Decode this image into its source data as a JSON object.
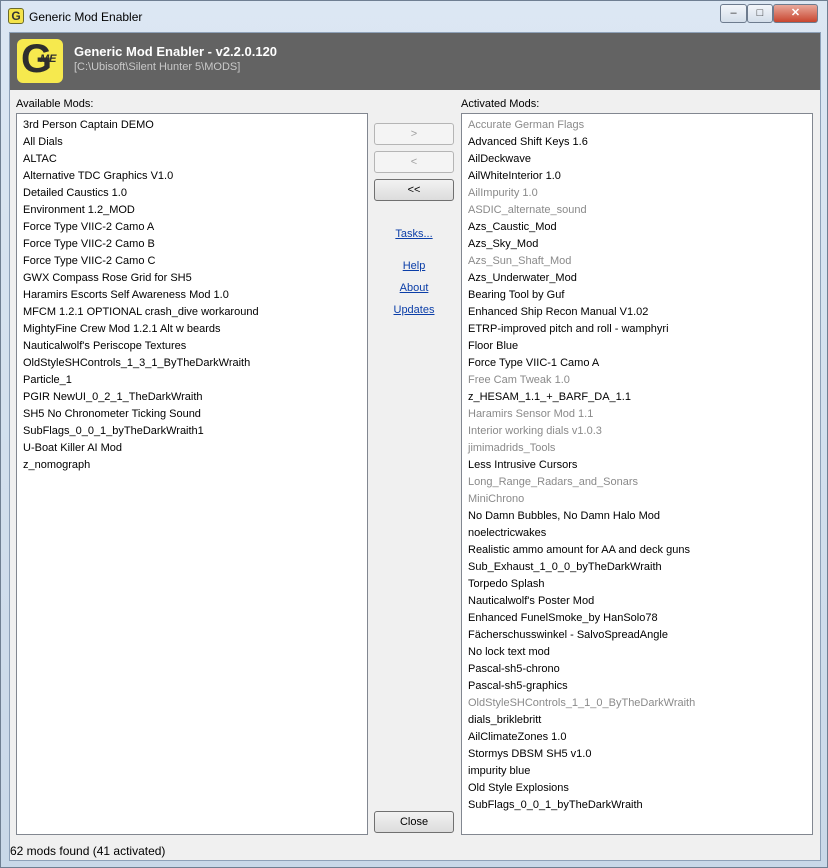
{
  "window": {
    "title": "Generic Mod Enabler",
    "controls": {
      "minimize": "–",
      "maximize": "□",
      "close": "✕"
    }
  },
  "banner": {
    "logo_letter": "G",
    "logo_sub": "ME",
    "title": "Generic Mod Enabler - v2.2.0.120",
    "path": "[C:\\Ubisoft\\Silent Hunter 5\\MODS]"
  },
  "available": {
    "label": "Available Mods:",
    "items": [
      "3rd Person Captain DEMO",
      "All Dials",
      "ALTAC",
      "Alternative TDC Graphics V1.0",
      "Detailed Caustics 1.0",
      "Environment 1.2_MOD",
      "Force Type VIIC-2 Camo A",
      "Force Type VIIC-2 Camo B",
      "Force Type VIIC-2 Camo C",
      "GWX Compass Rose Grid for SH5",
      "Haramirs Escorts Self Awareness Mod 1.0",
      "MFCM 1.2.1 OPTIONAL crash_dive workaround",
      "MightyFine Crew Mod 1.2.1 Alt w beards",
      "Nauticalwolf's Periscope Textures",
      "OldStyleSHControls_1_3_1_ByTheDarkWraith",
      "Particle_1",
      "PGIR NewUI_0_2_1_TheDarkWraith",
      "SH5 No Chronometer Ticking Sound",
      "SubFlags_0_0_1_byTheDarkWraith1",
      "U-Boat Killer AI Mod",
      "z_nomograph"
    ]
  },
  "activated": {
    "label": "Activated Mods:",
    "items": [
      {
        "text": "Accurate German Flags",
        "dim": true
      },
      {
        "text": "Advanced Shift Keys 1.6",
        "dim": false
      },
      {
        "text": "AilDeckwave",
        "dim": false
      },
      {
        "text": "AilWhiteInterior 1.0",
        "dim": false
      },
      {
        "text": "AilImpurity 1.0",
        "dim": true
      },
      {
        "text": "ASDIC_alternate_sound",
        "dim": true
      },
      {
        "text": "Azs_Caustic_Mod",
        "dim": false
      },
      {
        "text": "Azs_Sky_Mod",
        "dim": false
      },
      {
        "text": "Azs_Sun_Shaft_Mod",
        "dim": true
      },
      {
        "text": "Azs_Underwater_Mod",
        "dim": false
      },
      {
        "text": "Bearing Tool by Guf",
        "dim": false
      },
      {
        "text": "Enhanced Ship Recon Manual V1.02",
        "dim": false
      },
      {
        "text": "ETRP-improved pitch and roll - wamphyri",
        "dim": false
      },
      {
        "text": "Floor Blue",
        "dim": false
      },
      {
        "text": "Force Type VIIC-1 Camo A",
        "dim": false
      },
      {
        "text": "Free Cam Tweak 1.0",
        "dim": true
      },
      {
        "text": "z_HESAM_1.1_+_BARF_DA_1.1",
        "dim": false
      },
      {
        "text": "Haramirs Sensor Mod 1.1",
        "dim": true
      },
      {
        "text": "Interior working dials v1.0.3",
        "dim": true
      },
      {
        "text": "jimimadrids_Tools",
        "dim": true
      },
      {
        "text": "Less Intrusive Cursors",
        "dim": false
      },
      {
        "text": "Long_Range_Radars_and_Sonars",
        "dim": true
      },
      {
        "text": "MiniChrono",
        "dim": true
      },
      {
        "text": "No Damn Bubbles, No Damn Halo Mod",
        "dim": false
      },
      {
        "text": "noelectricwakes",
        "dim": false
      },
      {
        "text": "Realistic ammo amount for AA and deck guns",
        "dim": false
      },
      {
        "text": "Sub_Exhaust_1_0_0_byTheDarkWraith",
        "dim": false
      },
      {
        "text": "Torpedo Splash",
        "dim": false
      },
      {
        "text": "Nauticalwolf's Poster Mod",
        "dim": false
      },
      {
        "text": "Enhanced FunelSmoke_by HanSolo78",
        "dim": false
      },
      {
        "text": "Fächerschusswinkel - SalvoSpreadAngle",
        "dim": false
      },
      {
        "text": "No lock text mod",
        "dim": false
      },
      {
        "text": "Pascal-sh5-chrono",
        "dim": false
      },
      {
        "text": "Pascal-sh5-graphics",
        "dim": false
      },
      {
        "text": "OldStyleSHControls_1_1_0_ByTheDarkWraith",
        "dim": true
      },
      {
        "text": "dials_briklebritt",
        "dim": false
      },
      {
        "text": "AilClimateZones 1.0",
        "dim": false
      },
      {
        "text": "Stormys DBSM SH5 v1.0",
        "dim": false
      },
      {
        "text": "impurity blue",
        "dim": false
      },
      {
        "text": "Old Style Explosions",
        "dim": false
      },
      {
        "text": "SubFlags_0_0_1_byTheDarkWraith",
        "dim": false
      }
    ]
  },
  "buttons": {
    "activate": ">",
    "deactivate": "<",
    "deactivate_all": "<<",
    "close": "Close"
  },
  "links": {
    "tasks": "Tasks...",
    "help": "Help",
    "about": "About",
    "updates": "Updates"
  },
  "status": "62 mods found (41 activated)",
  "colors": {
    "banner": "#636363",
    "logo": "#f6e94e",
    "link": "#0b3ea8",
    "dim_text": "#8a8a8a"
  }
}
